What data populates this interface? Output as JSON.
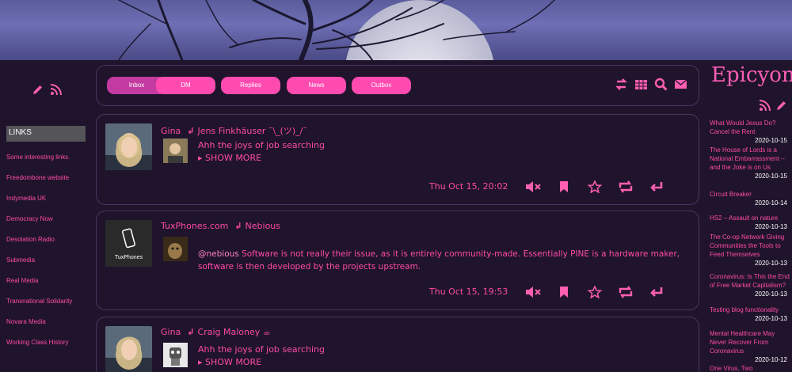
{
  "tabs": [
    "Inbox",
    "DM",
    "Replies",
    "News",
    "Outbox"
  ],
  "left": {
    "links_heading": "LINKS",
    "links": [
      "Some interesting links.",
      "Freedombone website",
      "Indymedia UK",
      "Democracy Now",
      "Desolation Radio",
      "Submedia",
      "Real Media",
      "Transnational Solidarity",
      "Novara Media",
      "Working Class History"
    ]
  },
  "posts": [
    {
      "author": "Gina",
      "reply_to": "Jens Finkhäuser ¯\\_(ツ)_/¯",
      "summary": "Ahh the joys of job searching",
      "show_more": "SHOW MORE",
      "date": "Thu Oct 15, 20:02"
    },
    {
      "author": "TuxPhones.com",
      "reply_to": "Nebious",
      "avatar_label": "TuxPhones",
      "mention": "@nebious",
      "text": " Software is not really their issue, as it is entirely community-made. Essentially PINE is a hardware maker, software is then developed by the projects upstream.",
      "date": "Thu Oct 15, 19:53"
    },
    {
      "author": "Gina",
      "reply_to": "Craig Maloney ☕",
      "summary": "Ahh the joys of job searching",
      "show_more": "SHOW MORE"
    }
  ],
  "right": {
    "brand": "Epicyon",
    "news": [
      {
        "title": "What Would Jesus Do? Cancel the Rent",
        "date": "2020-10-15"
      },
      {
        "title": "The House of Lords is a National Embarrassment – and the Joke is on Us",
        "date": "2020-10-15"
      },
      {
        "title": "Circuit Breaker",
        "date": "2020-10-14"
      },
      {
        "title": "HS2 – Assault on nature",
        "date": "2020-10-13"
      },
      {
        "title": "The Co-op Network Giving Communities the Tools to Feed Themselves",
        "date": "2020-10-13"
      },
      {
        "title": "Coronavirus: Is This the End of Free Market Capitalism?",
        "date": "2020-10-13"
      },
      {
        "title": "Testing blog functionality",
        "date": "2020-10-13"
      },
      {
        "title": "Mental Healthcare May Never Recover From Coronavirus",
        "date": "2020-10-12"
      },
      {
        "title": "One Virus, Two",
        "date": ""
      }
    ]
  },
  "colors": {
    "accent": "#ff4ba6",
    "tab_bg": "#ff4bb0",
    "tab_active": "#c33aa0",
    "page_bg": "#1f142c"
  }
}
